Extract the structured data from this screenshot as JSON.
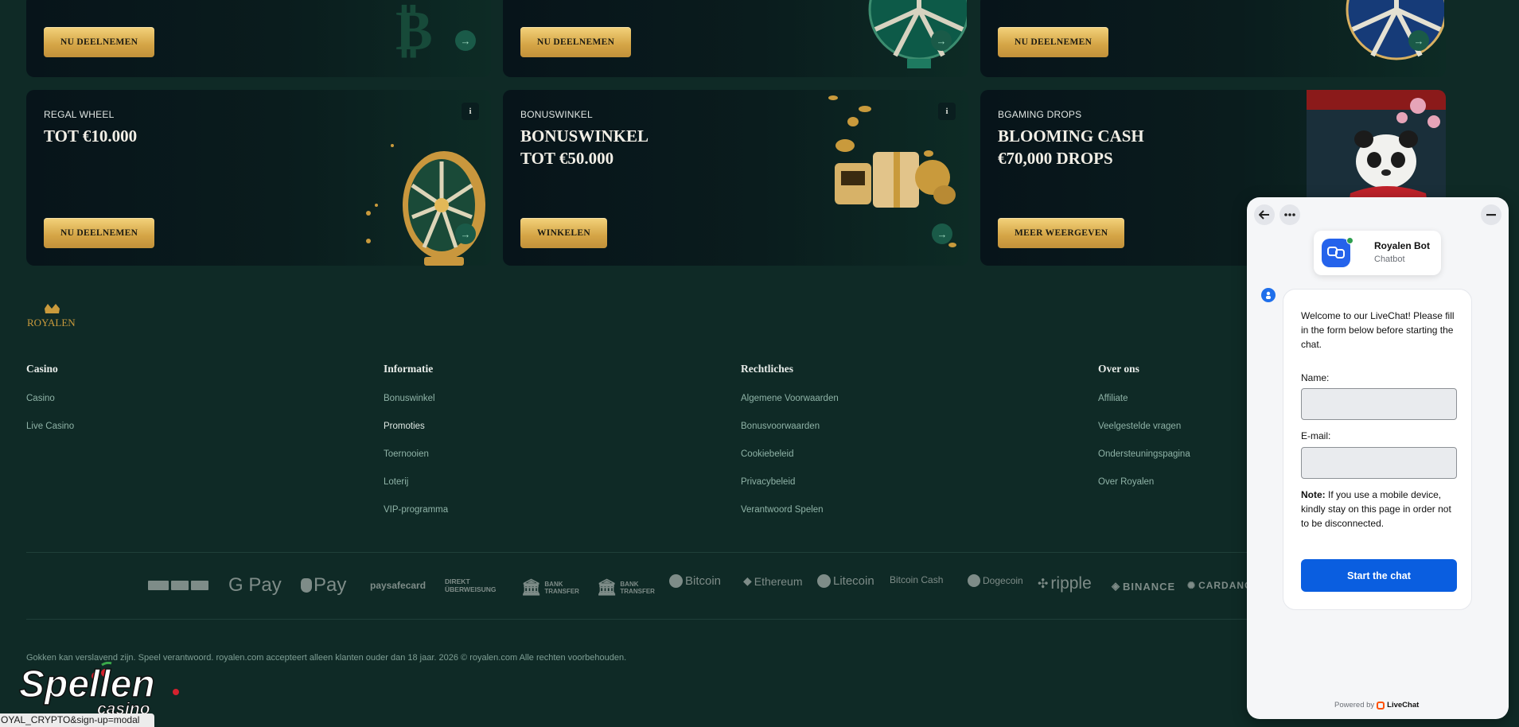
{
  "promo_top": [
    {
      "cta": "NU DEELNEMEN"
    },
    {
      "cta": "NU DEELNEMEN"
    },
    {
      "cta": "NU DEELNEMEN"
    }
  ],
  "promo_bottom": [
    {
      "tag": "REGAL WHEEL",
      "title": "TOT €10.000",
      "cta": "NU DEELNEMEN",
      "info": "i"
    },
    {
      "tag": "BONUSWINKEL",
      "title": "BONUSWINKEL\nTOT €50.000",
      "cta": "WINKELEN",
      "info": "i"
    },
    {
      "tag": "BGAMING DROPS",
      "title": "BLOOMING CASH\n€70,000 DROPS",
      "cta": "MEER WEERGEVEN"
    }
  ],
  "footer": {
    "logo_text": "ROYALEN",
    "columns": [
      {
        "heading": "Casino",
        "links": [
          "Casino",
          "Live Casino"
        ]
      },
      {
        "heading": "Informatie",
        "links": [
          "Bonuswinkel",
          "Promoties",
          "Toernooien",
          "Loterij",
          "VIP-programma"
        ]
      },
      {
        "heading": "Rechtliches",
        "links": [
          "Algemene Voorwaarden",
          "Bonusvoorwaarden",
          "Cookiebeleid",
          "Privacybeleid",
          "Verantwoord Spelen"
        ]
      },
      {
        "heading": "Over ons",
        "links": [
          "Affiliate",
          "Veelgestelde vragen",
          "Ondersteuningspagina",
          "Over Royalen"
        ]
      }
    ],
    "payments": [
      "G Pay",
      " Pay",
      "paysafecard",
      "DIREKT ÜBERWEISUNG",
      "BANK TRANSFER",
      "BANK TRANSFER",
      "Bitcoin",
      "Ethereum",
      "Litecoin",
      "Bitcoin Cash",
      "Dogecoin",
      "ripple",
      "BINANCE",
      "CARDANO"
    ],
    "legal": "Gokken kan verslavend zijn. Speel verantwoord. royalen.com accepteert alleen klanten ouder dan 18 jaar. 2026 © royalen.com Alle rechten voorbehouden."
  },
  "watermark": {
    "spellen": "Spellen",
    "casino": "casino"
  },
  "status_url": "OYAL_CRYPTO&sign-up=modal",
  "chat": {
    "bot_name": "Royalen Bot",
    "bot_role": "Chatbot",
    "welcome": "Welcome to our LiveChat! Please fill in the form below before starting the chat.",
    "name_label": "Name:",
    "email_label": "E-mail:",
    "note_bold": "Note:",
    "note_text": " If you use a mobile device, kindly stay on this page in order not to be disconnected.",
    "start_button": "Start the chat",
    "powered_by": "Powered by",
    "powered_brand": "LiveChat"
  },
  "colors": {
    "gold": "#d4a445",
    "bg": "#0f2a26",
    "chat_blue": "#0a5ee0",
    "livechat_orange": "#ff5100"
  }
}
